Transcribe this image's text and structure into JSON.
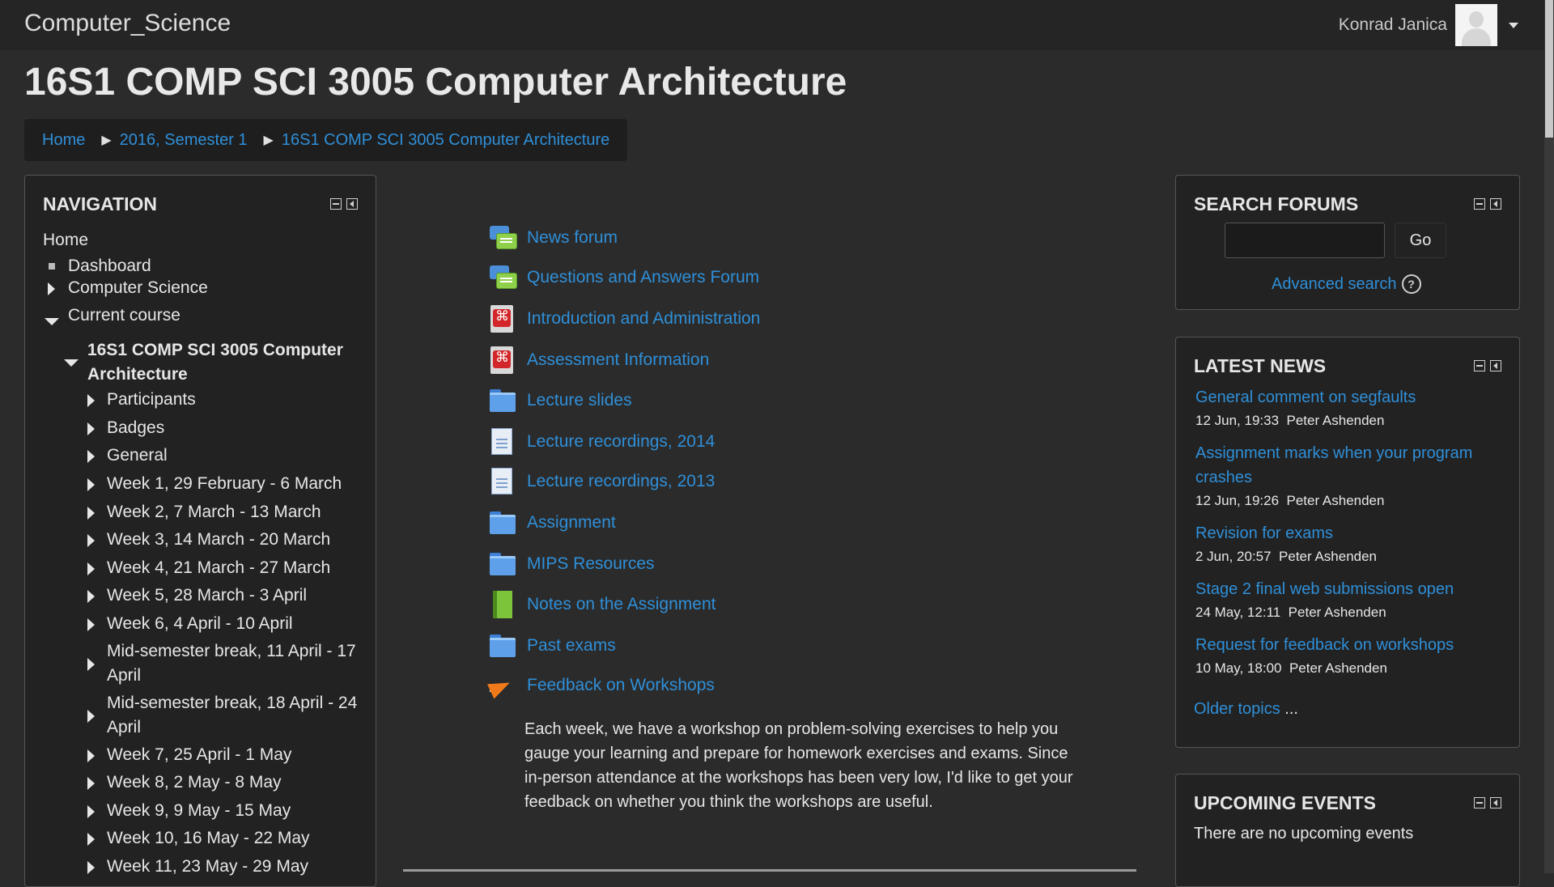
{
  "site": {
    "brand": "Computer_Science"
  },
  "user": {
    "name": "Konrad Janica"
  },
  "page": {
    "title": "16S1 COMP SCI 3005 Computer Architecture"
  },
  "breadcrumb": [
    {
      "label": "Home"
    },
    {
      "label": "2016, Semester 1"
    },
    {
      "label": "16S1 COMP SCI 3005 Computer Architecture"
    }
  ],
  "navigation": {
    "title": "NAVIGATION",
    "items": [
      {
        "label": "Home"
      },
      {
        "label": "Dashboard"
      },
      {
        "label": "Computer Science"
      },
      {
        "label": "Current course"
      },
      {
        "label": "16S1 COMP SCI 3005 Computer Architecture"
      },
      {
        "label": "Participants"
      },
      {
        "label": "Badges"
      },
      {
        "label": "General"
      },
      {
        "label": "Week 1, 29 February - 6 March"
      },
      {
        "label": "Week 2, 7 March - 13 March"
      },
      {
        "label": "Week 3, 14 March - 20 March"
      },
      {
        "label": "Week 4, 21 March - 27 March"
      },
      {
        "label": "Week 5, 28 March - 3 April"
      },
      {
        "label": "Week 6, 4 April - 10 April"
      },
      {
        "label": "Mid-semester break, 11 April - 17 April"
      },
      {
        "label": "Mid-semester break, 18 April - 24 April"
      },
      {
        "label": "Week 7, 25 April - 1 May"
      },
      {
        "label": "Week 8, 2 May - 8 May"
      },
      {
        "label": "Week 9, 9 May - 15 May"
      },
      {
        "label": "Week 10, 16 May - 22 May"
      },
      {
        "label": "Week 11, 23 May - 29 May"
      }
    ]
  },
  "activities": [
    {
      "label": "News forum",
      "icon": "forum-icon"
    },
    {
      "label": "Questions and Answers Forum",
      "icon": "forum-icon"
    },
    {
      "label": "Introduction and Administration",
      "icon": "pdf-icon"
    },
    {
      "label": "Assessment Information",
      "icon": "pdf-icon"
    },
    {
      "label": "Lecture slides",
      "icon": "folder-icon"
    },
    {
      "label": "Lecture recordings, 2014",
      "icon": "document-icon"
    },
    {
      "label": "Lecture recordings, 2013",
      "icon": "document-icon"
    },
    {
      "label": "Assignment",
      "icon": "folder-icon"
    },
    {
      "label": "MIPS Resources",
      "icon": "folder-icon"
    },
    {
      "label": "Notes on the Assignment",
      "icon": "book-icon"
    },
    {
      "label": "Past exams",
      "icon": "folder-icon"
    },
    {
      "label": "Feedback on Workshops",
      "icon": "megaphone-icon"
    }
  ],
  "feedback_description": "Each week, we have a workshop on problem-solving exercises to help you gauge your learning and prepare for homework exercises and exams. Since in-person attendance at the workshops has been very low, I'd like to get your feedback on whether you think the workshops are useful.",
  "search_forums": {
    "title": "SEARCH FORUMS",
    "input_value": "",
    "go_label": "Go",
    "advanced_label": "Advanced search",
    "help_glyph": "?"
  },
  "latest_news": {
    "title": "LATEST NEWS",
    "items": [
      {
        "title": "General comment on segfaults",
        "date": "12 Jun, 19:33",
        "author": "Peter Ashenden"
      },
      {
        "title": "Assignment marks when your program crashes",
        "date": "12 Jun, 19:26",
        "author": "Peter Ashenden"
      },
      {
        "title": "Revision for exams",
        "date": "2 Jun, 20:57",
        "author": "Peter Ashenden"
      },
      {
        "title": "Stage 2 final web submissions open",
        "date": "24 May, 12:11",
        "author": "Peter Ashenden"
      },
      {
        "title": "Request for feedback on workshops",
        "date": "10 May, 18:00",
        "author": "Peter Ashenden"
      }
    ],
    "older_label": "Older topics",
    "older_suffix": "..."
  },
  "upcoming_events": {
    "title": "UPCOMING EVENTS",
    "text": "There are no upcoming events"
  },
  "colors": {
    "link": "#2f8fd8",
    "background": "#2b2b2b",
    "block": "#222222"
  }
}
